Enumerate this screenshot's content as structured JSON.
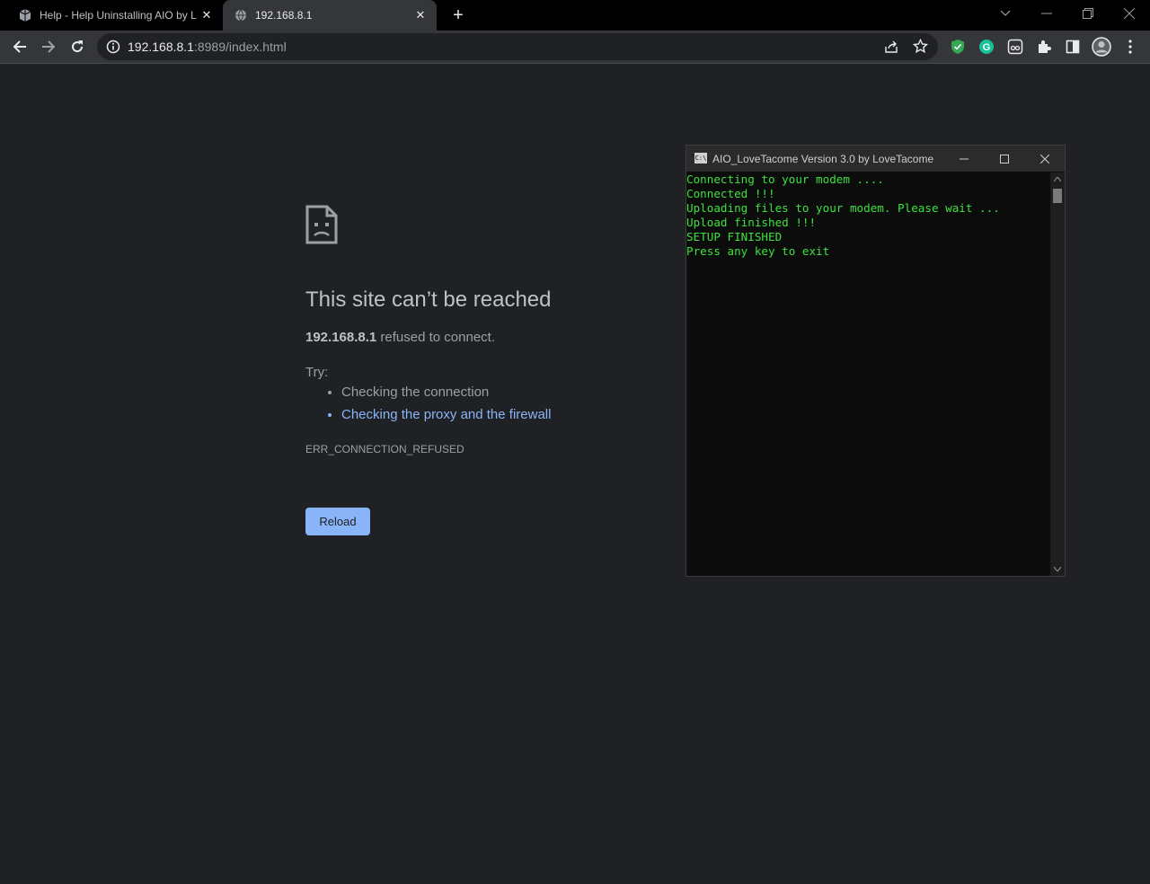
{
  "browser": {
    "tabs": [
      {
        "title": "Help - Help Uninstalling AIO by L",
        "active": false
      },
      {
        "title": "192.168.8.1",
        "active": true
      }
    ],
    "address": {
      "host": "192.168.8.1",
      "path": ":8989/index.html"
    }
  },
  "error_page": {
    "heading": "This site can’t be reached",
    "host": "192.168.8.1",
    "description_suffix": " refused to connect.",
    "try_label": "Try:",
    "suggestions": [
      "Checking the connection",
      "Checking the proxy and the firewall"
    ],
    "error_code": "ERR_CONNECTION_REFUSED",
    "reload_label": "Reload"
  },
  "console": {
    "icon_text": "C:\\",
    "title": "AIO_LoveTacome Version 3.0 by LoveTacome",
    "lines": [
      "Connecting to your modem ....",
      "Connected !!!",
      "Uploading files to your modem. Please wait ...",
      "Upload finished !!!",
      "SETUP FINISHED",
      "Press any key to exit"
    ],
    "text_color": "#3ee23e"
  },
  "colors": {
    "link": "#8ab4f8",
    "button": "#8ab4f8",
    "page_bg": "#202124"
  }
}
